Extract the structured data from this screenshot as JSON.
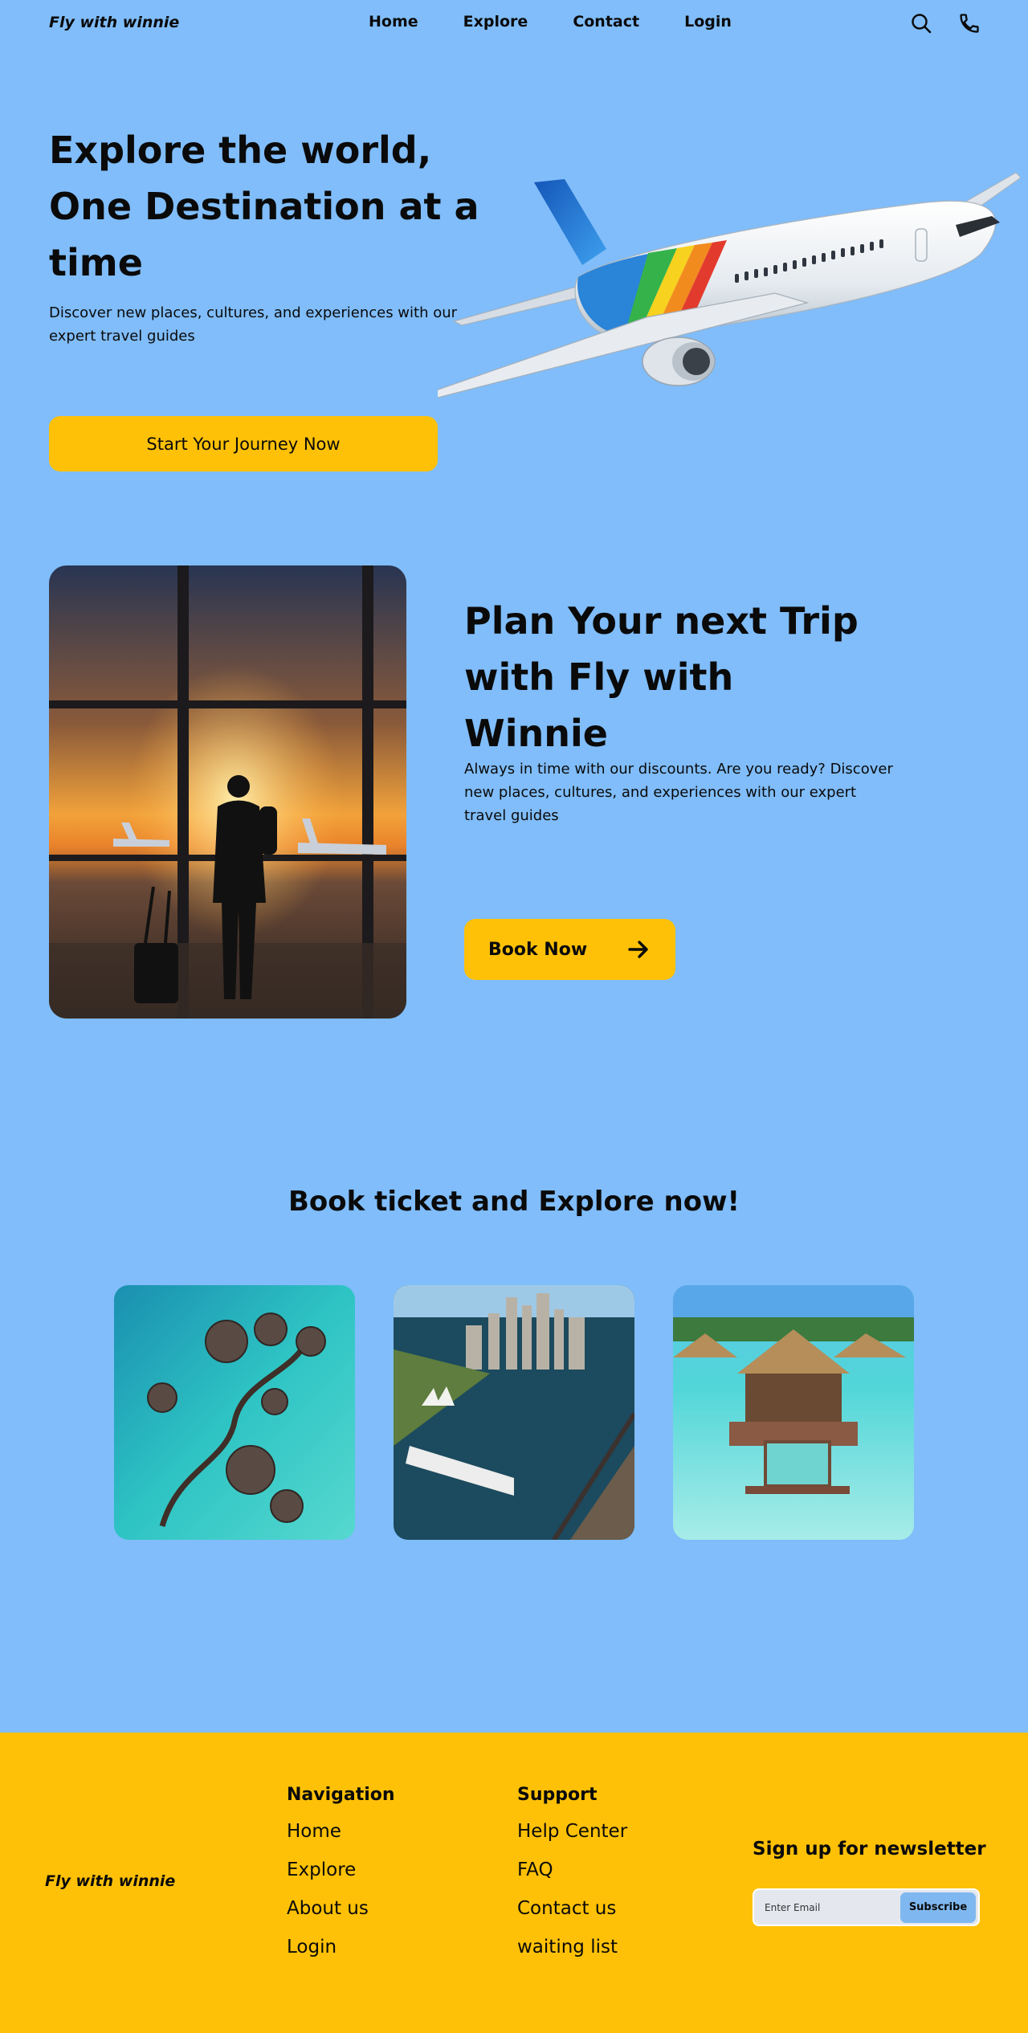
{
  "header": {
    "logo": "Fly with winnie",
    "nav": [
      "Home",
      "Explore",
      "Contact",
      "Login"
    ]
  },
  "hero": {
    "title": "Explore the world, One Destination at a time",
    "subtitle": "Discover new places, cultures, and experiences with our expert travel guides",
    "cta": "Start Your Journey Now"
  },
  "plan": {
    "title": "Plan Your next Trip with Fly with Winnie",
    "subtitle": "Always in time with our discounts. Are you ready? Discover new places, cultures, and experiences with our expert travel guides",
    "cta": "Book Now"
  },
  "explore": {
    "title": "Book ticket and Explore now!"
  },
  "footer": {
    "logo": "Fly with winnie",
    "navigation": {
      "heading": "Navigation",
      "links": [
        "Home",
        "Explore",
        "About us",
        "Login"
      ]
    },
    "support": {
      "heading": "Support",
      "links": [
        "Help Center",
        "FAQ",
        "Contact us",
        "waiting list"
      ]
    },
    "newsletter": {
      "title": "Sign up for newsletter",
      "placeholder": "Enter Email",
      "button": "Subscribe"
    }
  },
  "icons": {
    "search": "search-icon",
    "phone": "phone-icon",
    "arrow": "arrow-right-icon"
  },
  "colors": {
    "background": "#80bdfa",
    "accent": "#ffc107",
    "subscribe": "#7fb8f0"
  }
}
